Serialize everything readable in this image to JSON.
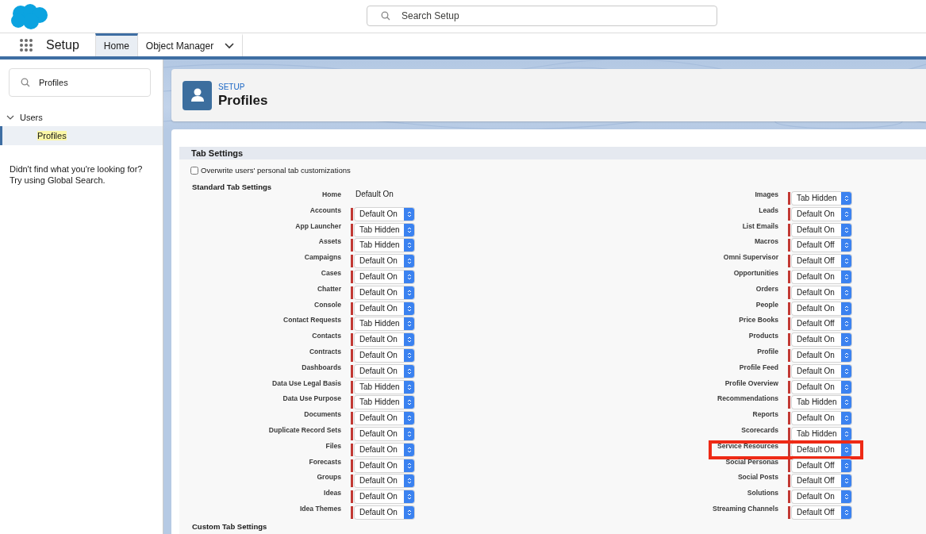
{
  "header": {
    "search": {
      "placeholder": "Search Setup"
    }
  },
  "nav": {
    "app_name": "Setup",
    "tabs": [
      {
        "label": "Home",
        "selected": true,
        "kind": "tab"
      },
      {
        "label": "Object Manager",
        "selected": false,
        "kind": "menu"
      }
    ]
  },
  "sidebar": {
    "search": {
      "value": "Profiles"
    },
    "tree": [
      {
        "label": "Users",
        "expanded": true,
        "children": [
          {
            "label": "Profiles",
            "selected": true
          }
        ]
      }
    ],
    "help": [
      "Didn't find what you're looking for?",
      "Try using Global Search."
    ]
  },
  "page_header": {
    "eyebrow": "SETUP",
    "title": "Profiles"
  },
  "tab_settings": {
    "title": "Tab Settings",
    "overwrite": {
      "label": "Overwrite users' personal tab customizations",
      "checked": false
    },
    "standard_title": "Standard Tab Settings",
    "left": [
      {
        "label": "Home",
        "kind": "text",
        "value": "Default On",
        "highlighted": false
      },
      {
        "label": "Accounts",
        "kind": "select",
        "value": "Default On",
        "highlighted": false
      },
      {
        "label": "App Launcher",
        "kind": "select",
        "value": "Tab Hidden",
        "highlighted": false
      },
      {
        "label": "Assets",
        "kind": "select",
        "value": "Tab Hidden",
        "highlighted": false
      },
      {
        "label": "Campaigns",
        "kind": "select",
        "value": "Default On",
        "highlighted": false
      },
      {
        "label": "Cases",
        "kind": "select",
        "value": "Default On",
        "highlighted": false
      },
      {
        "label": "Chatter",
        "kind": "select",
        "value": "Default On",
        "highlighted": false
      },
      {
        "label": "Console",
        "kind": "select",
        "value": "Default On",
        "highlighted": false
      },
      {
        "label": "Contact Requests",
        "kind": "select",
        "value": "Tab Hidden",
        "highlighted": false
      },
      {
        "label": "Contacts",
        "kind": "select",
        "value": "Default On",
        "highlighted": false
      },
      {
        "label": "Contracts",
        "kind": "select",
        "value": "Default On",
        "highlighted": false
      },
      {
        "label": "Dashboards",
        "kind": "select",
        "value": "Default On",
        "highlighted": false
      },
      {
        "label": "Data Use Legal Basis",
        "kind": "select",
        "value": "Tab Hidden",
        "highlighted": false
      },
      {
        "label": "Data Use Purpose",
        "kind": "select",
        "value": "Tab Hidden",
        "highlighted": false
      },
      {
        "label": "Documents",
        "kind": "select",
        "value": "Default On",
        "highlighted": false
      },
      {
        "label": "Duplicate Record Sets",
        "kind": "select",
        "value": "Default On",
        "highlighted": false
      },
      {
        "label": "Files",
        "kind": "select",
        "value": "Default On",
        "highlighted": false
      },
      {
        "label": "Forecasts",
        "kind": "select",
        "value": "Default On",
        "highlighted": false
      },
      {
        "label": "Groups",
        "kind": "select",
        "value": "Default On",
        "highlighted": false
      },
      {
        "label": "Ideas",
        "kind": "select",
        "value": "Default On",
        "highlighted": false
      },
      {
        "label": "Idea Themes",
        "kind": "select",
        "value": "Default On",
        "highlighted": false
      }
    ],
    "right": [
      {
        "label": "Images",
        "kind": "select",
        "value": "Tab Hidden",
        "highlighted": false
      },
      {
        "label": "Leads",
        "kind": "select",
        "value": "Default On",
        "highlighted": false
      },
      {
        "label": "List Emails",
        "kind": "select",
        "value": "Default On",
        "highlighted": false
      },
      {
        "label": "Macros",
        "kind": "select",
        "value": "Default Off",
        "highlighted": false
      },
      {
        "label": "Omni Supervisor",
        "kind": "select",
        "value": "Default Off",
        "highlighted": false
      },
      {
        "label": "Opportunities",
        "kind": "select",
        "value": "Default On",
        "highlighted": false
      },
      {
        "label": "Orders",
        "kind": "select",
        "value": "Default On",
        "highlighted": false
      },
      {
        "label": "People",
        "kind": "select",
        "value": "Default On",
        "highlighted": false
      },
      {
        "label": "Price Books",
        "kind": "select",
        "value": "Default Off",
        "highlighted": false
      },
      {
        "label": "Products",
        "kind": "select",
        "value": "Default On",
        "highlighted": false
      },
      {
        "label": "Profile",
        "kind": "select",
        "value": "Default On",
        "highlighted": false
      },
      {
        "label": "Profile Feed",
        "kind": "select",
        "value": "Default On",
        "highlighted": false
      },
      {
        "label": "Profile Overview",
        "kind": "select",
        "value": "Default On",
        "highlighted": false
      },
      {
        "label": "Recommendations",
        "kind": "select",
        "value": "Tab Hidden",
        "highlighted": false
      },
      {
        "label": "Reports",
        "kind": "select",
        "value": "Default On",
        "highlighted": false
      },
      {
        "label": "Scorecards",
        "kind": "select",
        "value": "Tab Hidden",
        "highlighted": false
      },
      {
        "label": "Service Resources",
        "kind": "select",
        "value": "Default On",
        "highlighted": true
      },
      {
        "label": "Social Personas",
        "kind": "select",
        "value": "Default Off",
        "highlighted": false
      },
      {
        "label": "Social Posts",
        "kind": "select",
        "value": "Default Off",
        "highlighted": false
      },
      {
        "label": "Solutions",
        "kind": "select",
        "value": "Default On",
        "highlighted": false
      },
      {
        "label": "Streaming Channels",
        "kind": "select",
        "value": "Default Off",
        "highlighted": false
      }
    ],
    "custom_title": "Custom Tab Settings"
  }
}
